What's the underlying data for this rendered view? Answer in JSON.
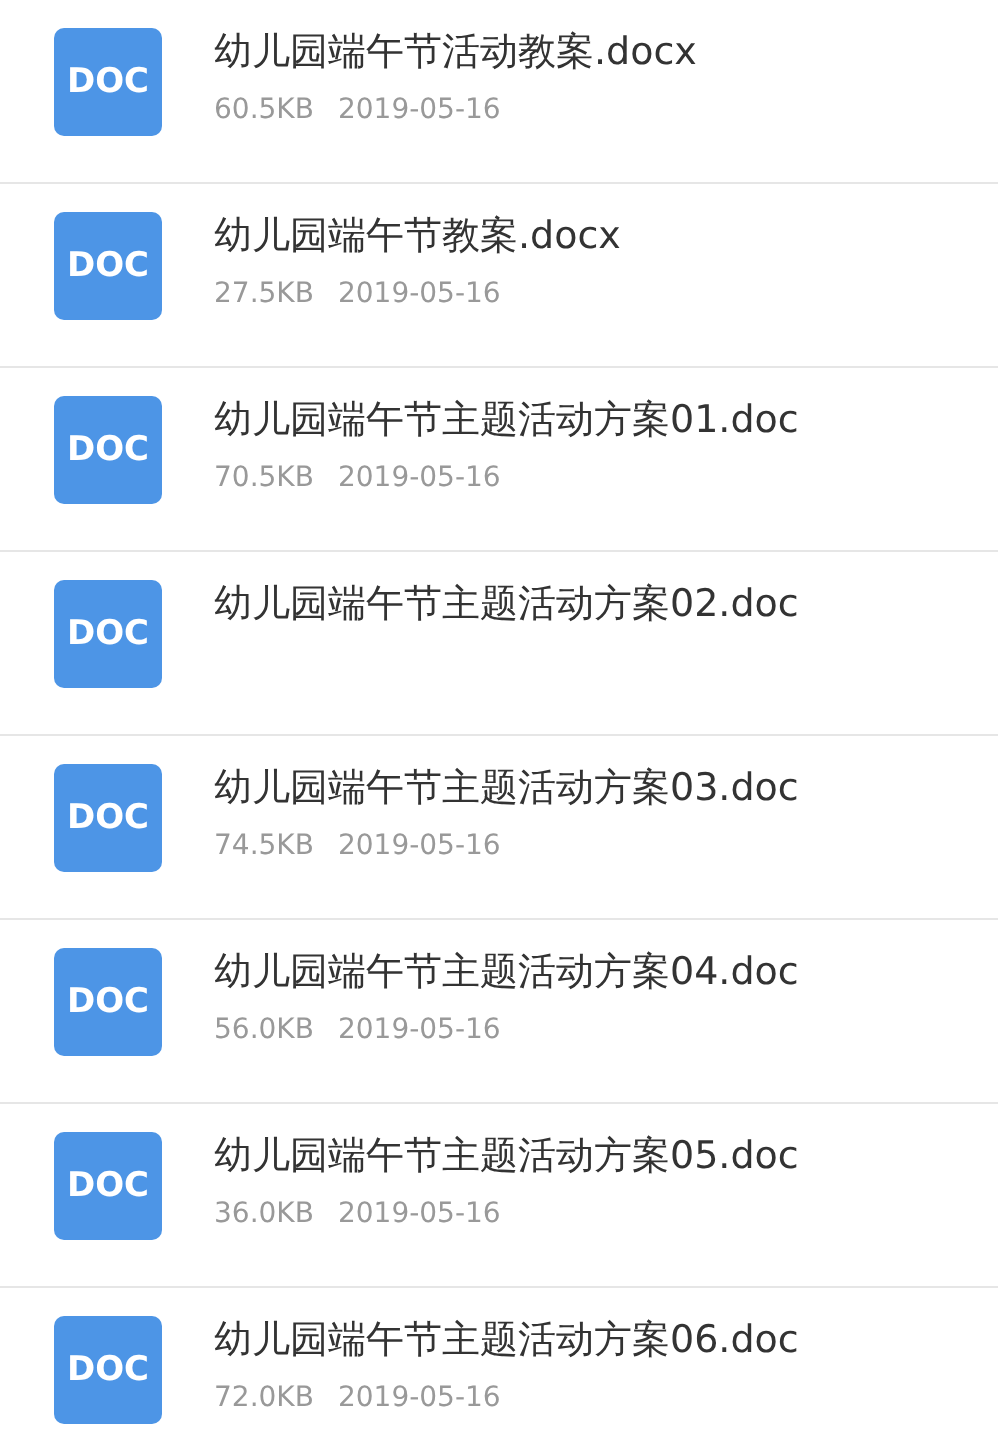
{
  "files": [
    {
      "icon": "DOC",
      "name": "幼儿园端午节活动教案.docx",
      "size": "60.5KB",
      "date": "2019-05-16"
    },
    {
      "icon": "DOC",
      "name": "幼儿园端午节教案.docx",
      "size": "27.5KB",
      "date": "2019-05-16"
    },
    {
      "icon": "DOC",
      "name": "幼儿园端午节主题活动方案01.doc",
      "size": "70.5KB",
      "date": "2019-05-16"
    },
    {
      "icon": "DOC",
      "name": "幼儿园端午节主题活动方案02.doc"
    },
    {
      "icon": "DOC",
      "name": "幼儿园端午节主题活动方案03.doc",
      "size": "74.5KB",
      "date": "2019-05-16"
    },
    {
      "icon": "DOC",
      "name": "幼儿园端午节主题活动方案04.doc",
      "size": "56.0KB",
      "date": "2019-05-16"
    },
    {
      "icon": "DOC",
      "name": "幼儿园端午节主题活动方案05.doc",
      "size": "36.0KB",
      "date": "2019-05-16"
    },
    {
      "icon": "DOC",
      "name": "幼儿园端午节主题活动方案06.doc",
      "size": "72.0KB",
      "date": "2019-05-16"
    }
  ]
}
